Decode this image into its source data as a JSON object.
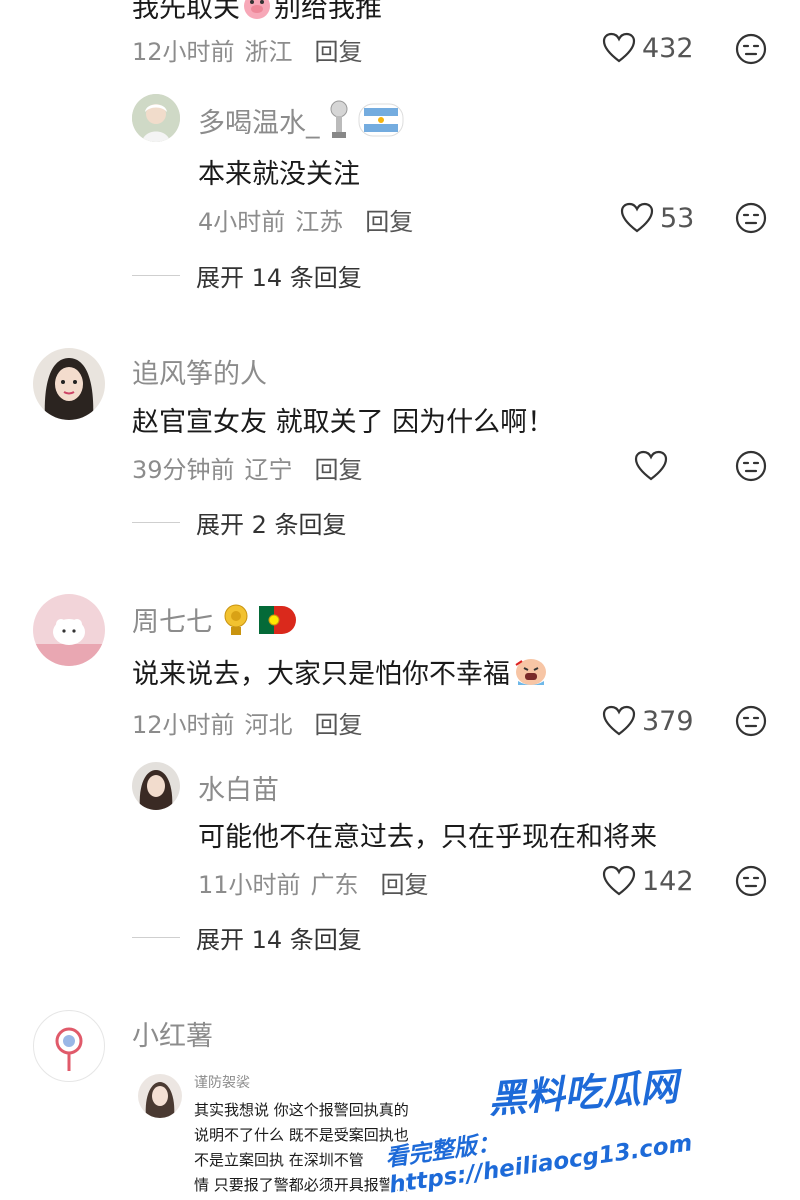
{
  "comments": [
    {
      "text_partial_left": "我先取关",
      "text_partial_right": "别给我推",
      "time": "12小时前",
      "location": "浙江",
      "reply_label": "回复",
      "likes": "432",
      "replies": [
        {
          "name": "多喝温水_",
          "text": "本来就没关注",
          "time": "4小时前",
          "location": "江苏",
          "reply_label": "回复",
          "likes": "53"
        }
      ],
      "expand_label": "展开 14 条回复"
    },
    {
      "name": "追风筝的人",
      "text": "赵官宣女友 就取关了 因为什么啊！",
      "time": "39分钟前",
      "location": "辽宁",
      "reply_label": "回复",
      "likes": "",
      "expand_label": "展开 2 条回复"
    },
    {
      "name": "周七七",
      "text": "说来说去，大家只是怕你不幸福",
      "time": "12小时前",
      "location": "河北",
      "reply_label": "回复",
      "likes": "379",
      "replies": [
        {
          "name": "水白苗",
          "text": "可能他不在意过去，只在乎现在和将来",
          "time": "11小时前",
          "location": "广东",
          "reply_label": "回复",
          "likes": "142"
        }
      ],
      "expand_label": "展开 14 条回复"
    },
    {
      "name": "小红薯",
      "embedded_name": "谨防袈裟",
      "embedded_lines": [
        "其实我想说 你这个报警回执真的",
        "说明不了什么 既不是受案回执也",
        "不是立案回执 在深圳不管",
        "情 只要报了警都必须开具报警回"
      ]
    }
  ],
  "watermark": {
    "title": "黑料吃瓜网",
    "subtitle": "看完整版：https://heiliaocg13.com"
  },
  "colors": {
    "text_primary": "#1a1a1a",
    "text_secondary": "#8c8c8c",
    "watermark": "#1d6ad8"
  }
}
